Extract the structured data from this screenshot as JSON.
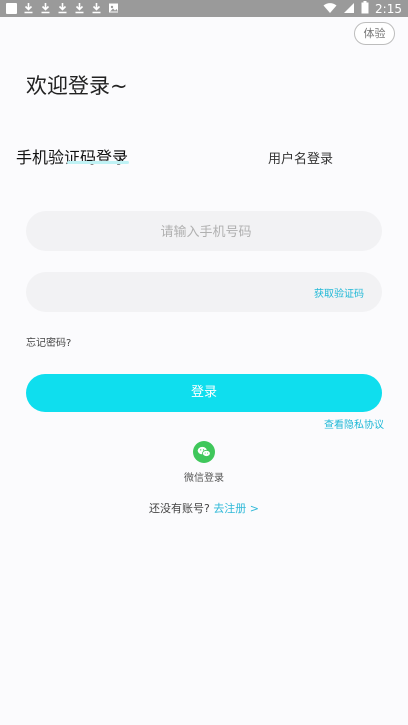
{
  "status_bar": {
    "time": "2:15"
  },
  "header": {
    "trial_label": "体验",
    "welcome_title": "欢迎登录~"
  },
  "tabs": {
    "phone_login": "手机验证码登录",
    "username_login": "用户名登录"
  },
  "form": {
    "phone_placeholder": "请输入手机号码",
    "code_placeholder": "",
    "get_code_label": "获取验证码",
    "forgot_label": "忘记密码?",
    "login_label": "登录",
    "privacy_label": "查看隐私协议"
  },
  "social": {
    "wechat_label": "微信登录"
  },
  "register": {
    "prompt": "还没有账号?",
    "link": "去注册 >"
  },
  "colors": {
    "accent": "#0fdeee",
    "link": "#1fb8d6",
    "wechat": "#3fc75b"
  },
  "icons": [
    "notification-box-icon",
    "download-icon",
    "download-icon",
    "download-icon",
    "download-icon",
    "download-icon",
    "image-icon",
    "wifi-icon",
    "signal-icon",
    "battery-icon",
    "wechat-icon"
  ]
}
